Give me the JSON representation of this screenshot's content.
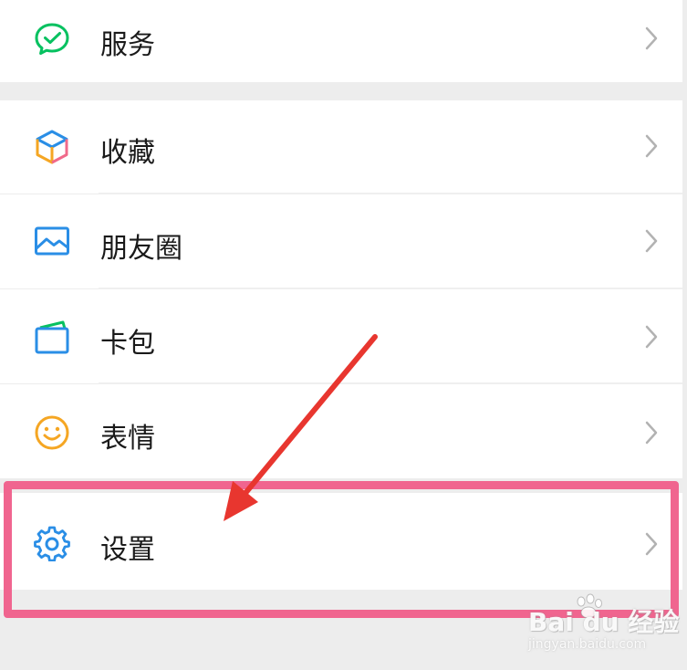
{
  "menu": {
    "items": [
      {
        "id": "services",
        "label": "服务",
        "icon": "wechat-pay-icon"
      },
      {
        "id": "favorites",
        "label": "收藏",
        "icon": "cube-icon"
      },
      {
        "id": "moments",
        "label": "朋友圈",
        "icon": "image-icon"
      },
      {
        "id": "cards",
        "label": "卡包",
        "icon": "card-wallet-icon"
      },
      {
        "id": "stickers",
        "label": "表情",
        "icon": "smiley-icon"
      },
      {
        "id": "settings",
        "label": "设置",
        "icon": "gear-icon"
      }
    ],
    "chevron_icon": "chevron-right-icon"
  },
  "annotation": {
    "highlight_color": "#f0658f",
    "arrow_color": "#e8362f"
  },
  "watermark": {
    "main": "Bai du 经验",
    "sub": "jingyan.baidu.com"
  },
  "colors": {
    "background": "#ededed",
    "row": "#ffffff",
    "text": "#1a1a1a",
    "chevron": "#b2b2b2",
    "green": "#07c160",
    "blue": "#2a8ee6",
    "orange": "#f5a623"
  }
}
